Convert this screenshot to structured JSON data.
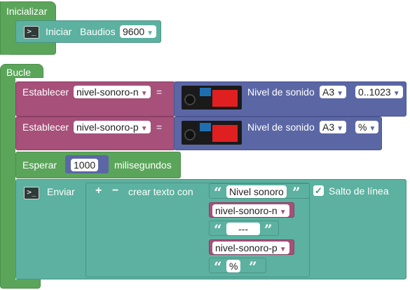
{
  "setup": {
    "title": "Inicializar",
    "serial_begin": {
      "label_init": "Iniciar",
      "label_baud": "Baudios",
      "baud_value": "9600"
    }
  },
  "loop": {
    "title": "Bucle",
    "set1": {
      "label": "Establecer",
      "var": "nivel-sonoro-n",
      "eq": "=",
      "sensor_label": "Nivel de sonido",
      "pin": "A3",
      "range": "0..1023"
    },
    "set2": {
      "label": "Establecer",
      "var": "nivel-sonoro-p",
      "eq": "=",
      "sensor_label": "Nivel de sonido",
      "pin": "A3",
      "range": "%"
    },
    "wait": {
      "label": "Esperar",
      "value": "1000",
      "unit": "milisegundos"
    },
    "send": {
      "label": "Enviar",
      "plus": "+",
      "minus": "−",
      "create_text": "crear texto con",
      "newline_label": "Salto de línea",
      "newline_checked": true,
      "items": {
        "t1": "Nivel sonoro",
        "v1": "nivel-sonoro-n",
        "t2": "---",
        "v2": "nivel-sonoro-p",
        "t3": "%"
      }
    }
  },
  "colors": {
    "event": "#5ba55b",
    "serial": "#5cb1a0",
    "variable": "#a6507a",
    "sensor": "#5b67a5"
  },
  "icons": {
    "terminal": "terminal-icon",
    "dropdown": "triangle-down-icon",
    "checkbox": "check-icon",
    "sensor_module": "sound-sensor-module-image"
  }
}
